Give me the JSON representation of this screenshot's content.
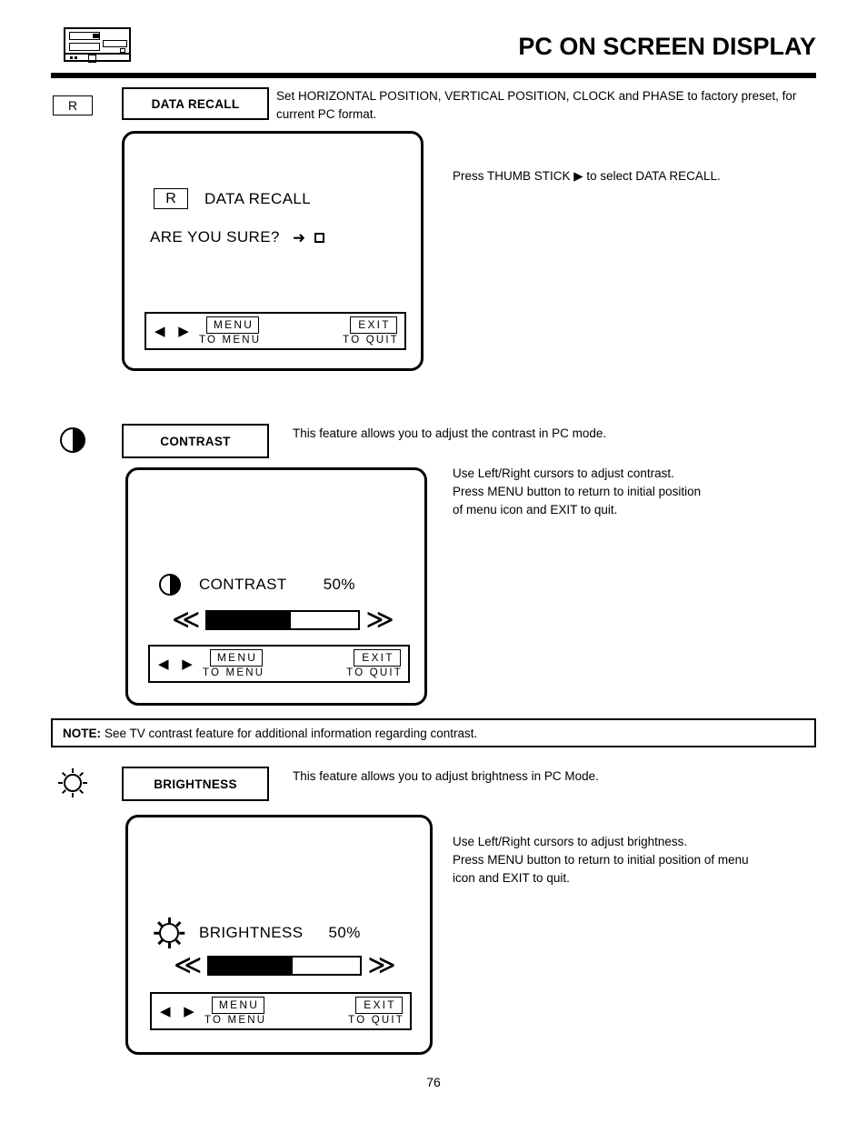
{
  "header": {
    "title": "PC ON SCREEN DISPLAY",
    "icon": "pc-monitor-icon"
  },
  "sections": [
    {
      "id": "data-recall",
      "margin_icon": "r-badge-icon",
      "margin_icon_label": "R",
      "label": "DATA RECALL",
      "description": "Set HORIZONTAL POSITION, VERTICAL POSITION, CLOCK  and PHASE to factory preset, for current PC format.",
      "instructions": "Press THUMB STICK ▶ to select DATA RECALL.",
      "osd": {
        "badge": "R",
        "title": "DATA RECALL",
        "question": "ARE YOU SURE?",
        "arrow": "➜",
        "checkbox": "empty-checkbox-icon",
        "footer": {
          "cursors": "◀ ▶",
          "menu_key": "MENU",
          "menu_sub": "TO MENU",
          "exit_key": "EXIT",
          "exit_sub": "TO QUIT"
        }
      }
    },
    {
      "id": "contrast",
      "margin_icon": "contrast-half-circle-icon",
      "label": "CONTRAST",
      "description": "This feature allows you to adjust the contrast in PC mode.",
      "instructions": "Use Left/Right cursors to adjust contrast.\nPress MENU button to return to initial position\nof menu icon and EXIT to quit.",
      "osd": {
        "icon": "contrast-half-circle-icon",
        "title": "CONTRAST",
        "value": "50%",
        "slider_fill_percent": 55,
        "left_chevron": "≪",
        "right_chevron": "≫",
        "footer": {
          "cursors": "◀ ▶",
          "menu_key": "MENU",
          "menu_sub": "TO MENU",
          "exit_key": "EXIT",
          "exit_sub": "TO QUIT"
        }
      }
    },
    {
      "id": "brightness",
      "margin_icon": "sun-icon",
      "label": "BRIGHTNESS",
      "description": "This feature allows you to adjust brightness in PC Mode.",
      "instructions": "Use Left/Right cursors to adjust brightness.\nPress MENU button to return to initial position of menu\nicon and EXIT to quit.",
      "osd": {
        "icon": "sun-icon",
        "title": "BRIGHTNESS",
        "value": "50%",
        "slider_fill_percent": 55,
        "left_chevron": "≪",
        "right_chevron": "≫",
        "footer": {
          "cursors": "◀ ▶",
          "menu_key": "MENU",
          "menu_sub": "TO MENU",
          "exit_key": "EXIT",
          "exit_sub": "TO QUIT"
        }
      }
    }
  ],
  "note": {
    "prefix": "NOTE:",
    "text": "See TV contrast feature for additional information regarding contrast."
  },
  "page_number": "76"
}
